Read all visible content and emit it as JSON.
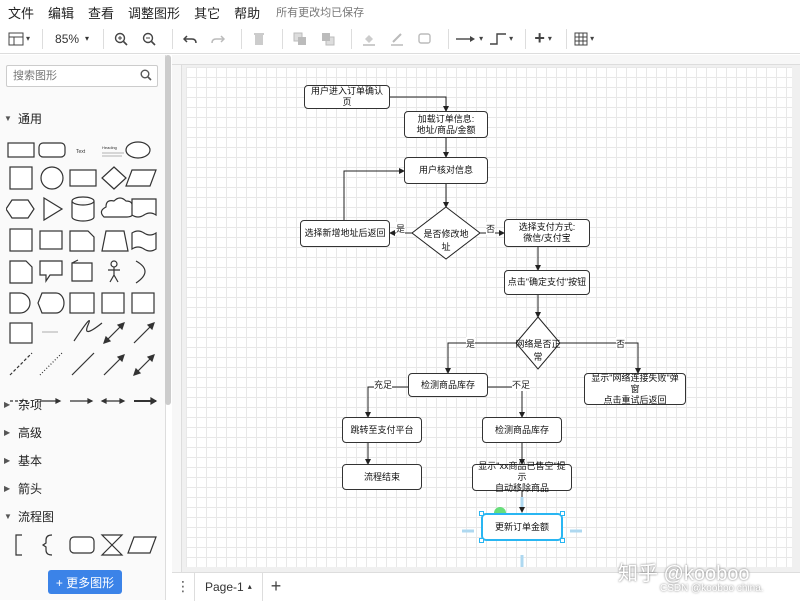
{
  "menu": {
    "items": [
      "文件",
      "编辑",
      "查看",
      "调整图形",
      "其它",
      "帮助"
    ],
    "saved_status": "所有更改均已保存"
  },
  "toolbar": {
    "zoom": "85%"
  },
  "sidebar": {
    "search_placeholder": "搜索图形",
    "sections": {
      "general": "通用",
      "misc": "杂项",
      "advanced": "高级",
      "basic": "基本",
      "arrows": "箭头",
      "flowchart": "流程图"
    },
    "shape_text": "Text",
    "shape_heading": "Heading",
    "more_shapes": "+ 更多图形"
  },
  "bottom": {
    "page_tab": "Page-1"
  },
  "diagram": {
    "n1": "用户进入订单确认页",
    "n2": "加载订单信息:\n地址/商品/金额",
    "n3": "用户核对信息",
    "d1": "是否修改地址",
    "n4": "选择新增地址后返回",
    "n5": "选择支付方式:\n微信/支付宝",
    "n6": "点击\"确定支付\"按钮",
    "d2": "网络是否正常",
    "n7": "检测商品库存",
    "n8": "显示\"网络连接失败\"弹窗\n点击重试后返回",
    "n9": "跳转至支付平台",
    "n10": "检测商品库存",
    "n11": "流程结束",
    "n12": "显示\"xx商品已售空\"提示\n自动移除商品",
    "n13": "更新订单金额",
    "yes1": "是",
    "no1": "否",
    "yes2": "是",
    "no2": "否",
    "enough": "充足",
    "short": "不足"
  },
  "watermark": {
    "line1": "知乎 @kooboo",
    "line2": "CSDN @kooboo china."
  },
  "colors": {
    "accent": "#3b83e8",
    "selection": "#29b6f2",
    "selection_dot": "#4cd964"
  }
}
